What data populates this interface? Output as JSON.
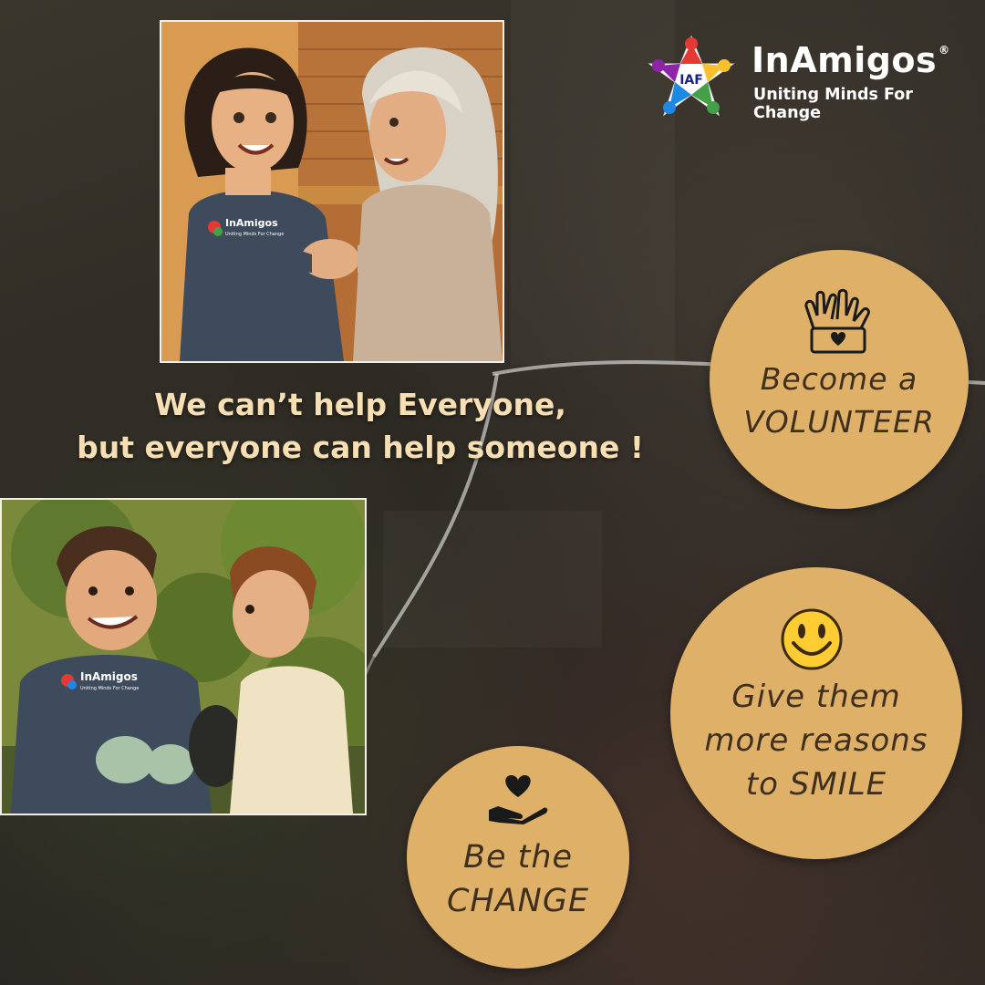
{
  "brand": {
    "name": "InAmigos",
    "registered": "®",
    "tagline": "Uniting Minds For Change",
    "mark_letters": "IAF"
  },
  "quote": {
    "line1": "We can’t help Everyone,",
    "line2": "but everyone can help someone !"
  },
  "callouts": [
    {
      "line1": "Become a",
      "line2": "VOLUNTEER",
      "icon": "raised-hands-heart-icon"
    },
    {
      "line1": "Give them",
      "line2": "more reasons",
      "line3": "to SMILE",
      "icon": "smiley-face-icon"
    },
    {
      "line1": "Be the",
      "line2": "CHANGE",
      "icon": "hand-holding-heart-icon"
    }
  ],
  "shirt": {
    "brand": "InAmigos",
    "tagline": "Uniting Minds For Change"
  },
  "colors": {
    "accent_circle": "#dfb068",
    "quote_text": "#f7dfb3",
    "callout_text": "#3f2f1d"
  }
}
